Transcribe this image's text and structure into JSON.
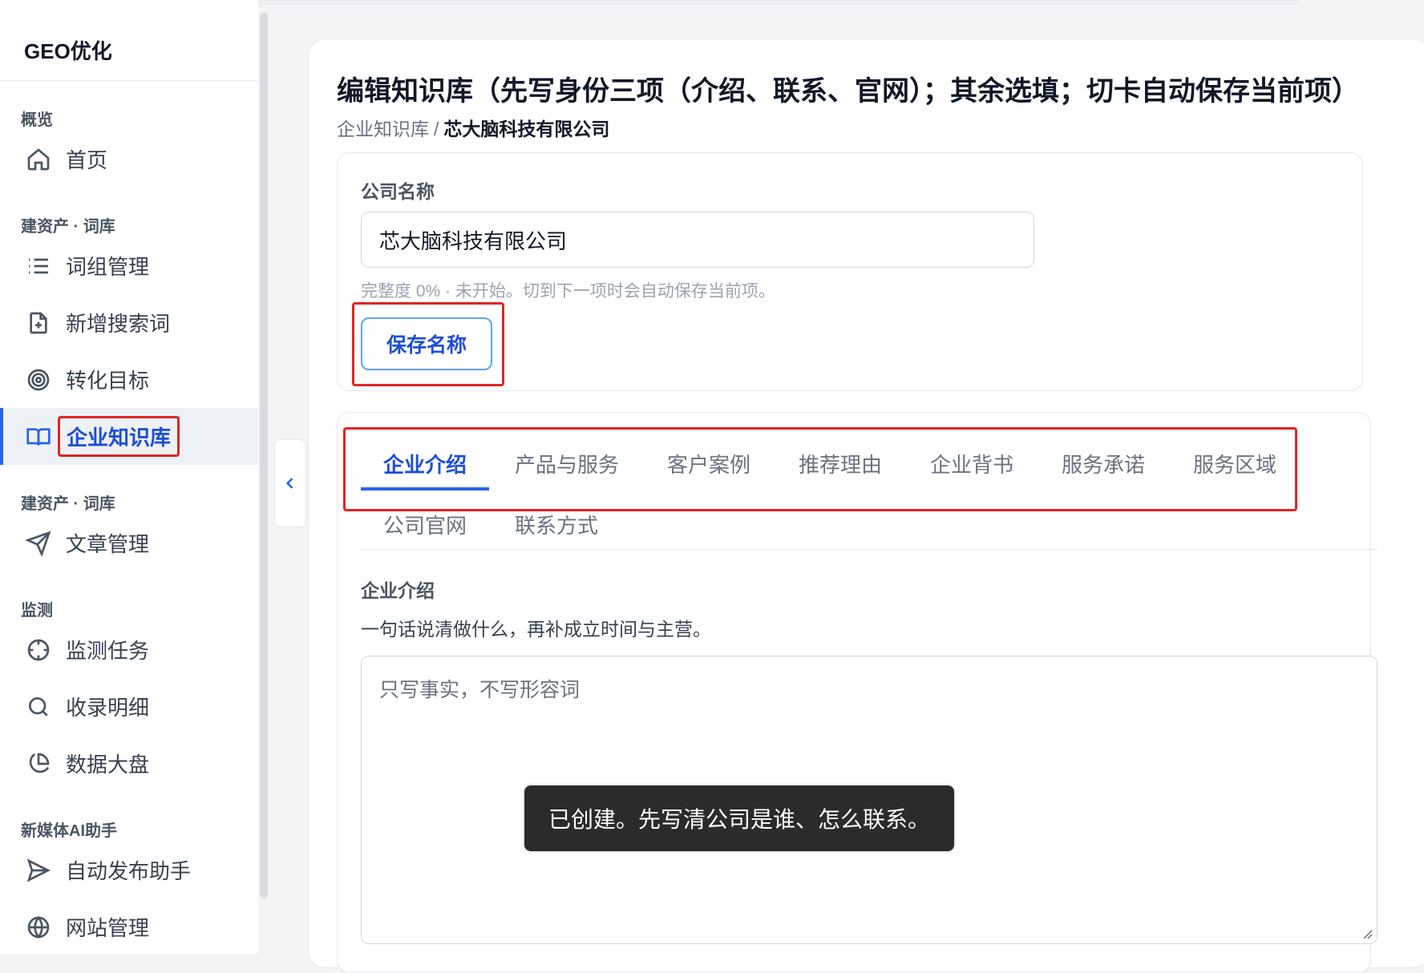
{
  "app": {
    "brand": "GEO优化"
  },
  "sidebar": {
    "groups": [
      {
        "title": "概览",
        "items": [
          {
            "label": "首页",
            "icon": "home-icon"
          }
        ]
      },
      {
        "title": "建资产 · 词库",
        "items": [
          {
            "label": "词组管理",
            "icon": "list-icon"
          },
          {
            "label": "新增搜索词",
            "icon": "file-plus-icon"
          },
          {
            "label": "转化目标",
            "icon": "target-icon"
          },
          {
            "label": "企业知识库",
            "icon": "book-icon",
            "active": true
          }
        ]
      },
      {
        "title": "建资产 · 词库",
        "items": [
          {
            "label": "文章管理",
            "icon": "send-icon"
          }
        ]
      },
      {
        "title": "监测",
        "items": [
          {
            "label": "监测任务",
            "icon": "crosshair-icon"
          },
          {
            "label": "收录明细",
            "icon": "search-icon"
          },
          {
            "label": "数据大盘",
            "icon": "pie-chart-icon"
          }
        ]
      },
      {
        "title": "新媒体AI助手",
        "items": [
          {
            "label": "自动发布助手",
            "icon": "send-outline-icon"
          },
          {
            "label": "网站管理",
            "icon": "globe-icon"
          }
        ]
      }
    ]
  },
  "main": {
    "title": "编辑知识库（先写身份三项（介绍、联系、官网）；其余选填；切卡自动保存当前项）",
    "breadcrumb": {
      "parent": "企业知识库",
      "separator": "/",
      "current": "芯大脑科技有限公司"
    },
    "company_name": {
      "label": "公司名称",
      "value": "芯大脑科技有限公司",
      "hint": "完整度 0% · 未开始。切到下一项时会自动保存当前项。",
      "save_label": "保存名称"
    },
    "tabs": [
      {
        "label": "企业介绍",
        "active": true
      },
      {
        "label": "产品与服务"
      },
      {
        "label": "客户案例"
      },
      {
        "label": "推荐理由"
      },
      {
        "label": "企业背书"
      },
      {
        "label": "服务承诺"
      },
      {
        "label": "服务区域"
      },
      {
        "label": "公司官网"
      },
      {
        "label": "联系方式"
      }
    ],
    "section": {
      "title": "企业介绍",
      "description": "一句话说清做什么，再补成立时间与主营。",
      "placeholder": "只写事实，不写形容词"
    },
    "toast": "已创建。先写清公司是谁、怎么联系。"
  },
  "colors": {
    "accent": "#2563eb",
    "highlight_box": "#e02424",
    "toast_bg": "#2b2b2b"
  }
}
